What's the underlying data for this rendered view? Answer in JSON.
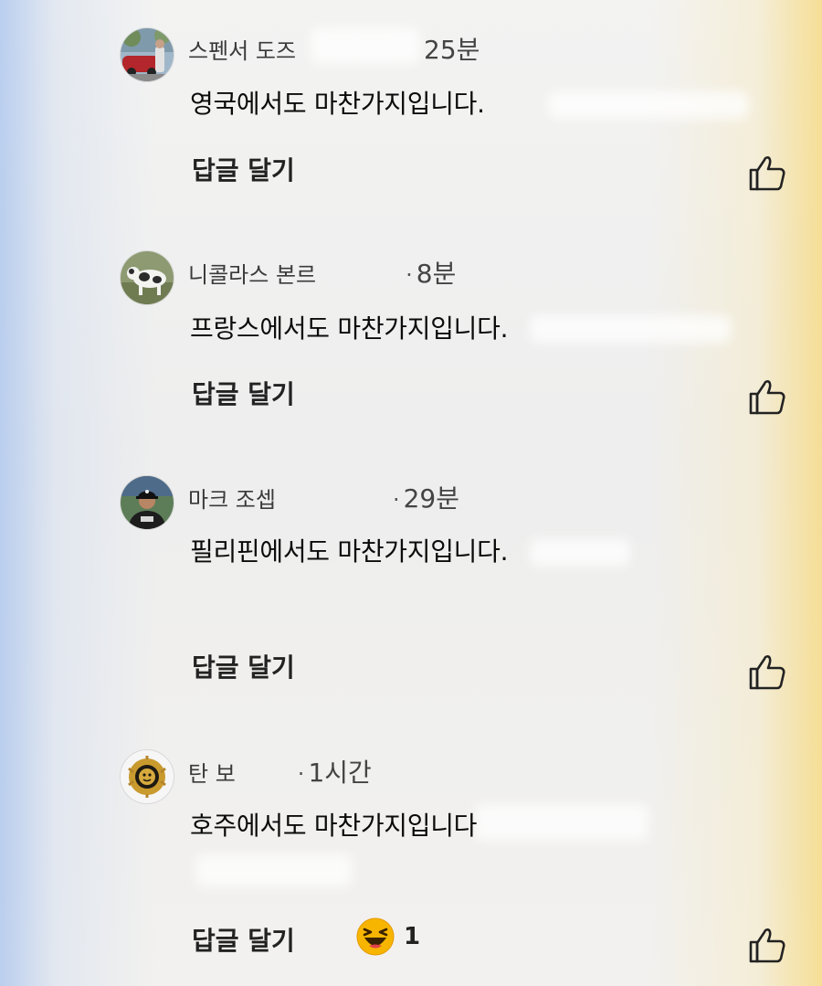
{
  "comments": [
    {
      "name": "스펜서 도즈",
      "time": "25분",
      "text": "영국에서도 마찬가지입니다.",
      "reply_label": "답글 달기",
      "avatar_icon": "person-avatar-car"
    },
    {
      "name": "니콜라스 본르",
      "time": "8분",
      "text": "프랑스에서도 마찬가지입니다.",
      "reply_label": "답글 달기",
      "avatar_icon": "dog-avatar"
    },
    {
      "name": "마크 조셉",
      "time": "29분",
      "text": "필리핀에서도 마찬가지입니다.",
      "reply_label": "답글 달기",
      "avatar_icon": "person-avatar-cap"
    },
    {
      "name": "탄 보",
      "time": "1시간",
      "text": "호주에서도 마찬가지입니다",
      "reply_label": "답글 달기",
      "avatar_icon": "gold-emblem-avatar",
      "reaction": {
        "emoji": "laughing-emoji",
        "count": "1"
      }
    }
  ],
  "separator": "·",
  "colors": {
    "text": "#0b0b0b",
    "meta": "#3a3a3a",
    "reply": "#222222",
    "emoji": "#f7b500"
  }
}
